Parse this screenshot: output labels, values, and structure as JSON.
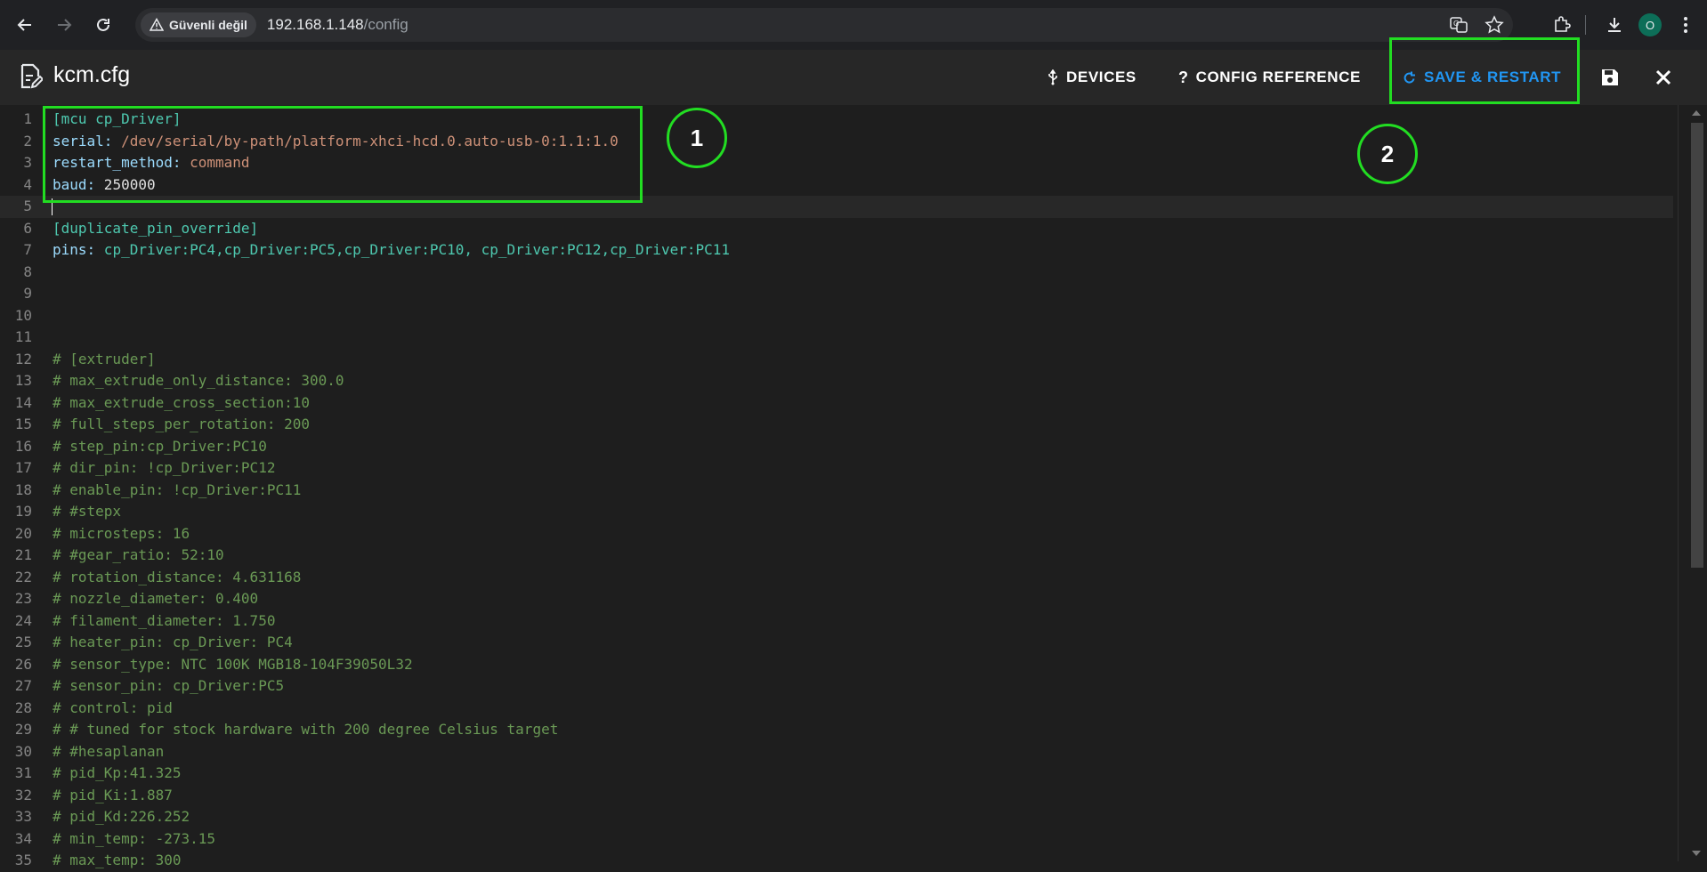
{
  "browser": {
    "security_label": "Güvenli değil",
    "url_host": "192.168.1.148",
    "url_path": "/config",
    "profile_initial": "O"
  },
  "header": {
    "file_name": "kcm.cfg",
    "devices_label": "DEVICES",
    "config_reference_label": "CONFIG REFERENCE",
    "save_restart_label": "SAVE & RESTART"
  },
  "editor": {
    "current_line": 5,
    "lines": [
      {
        "n": "1",
        "segs": [
          {
            "t": "[mcu cp_Driver]",
            "c": "section"
          }
        ]
      },
      {
        "n": "2",
        "segs": [
          {
            "t": "serial:",
            "c": "key"
          },
          {
            "t": " /dev/serial/by-path/platform-xhci-hcd.0.auto-usb-0:1.1:1.0",
            "c": "val"
          }
        ]
      },
      {
        "n": "3",
        "segs": [
          {
            "t": "restart_method:",
            "c": "key"
          },
          {
            "t": " command",
            "c": "val"
          }
        ]
      },
      {
        "n": "4",
        "segs": [
          {
            "t": "baud:",
            "c": "key"
          },
          {
            "t": " 250000",
            "c": "num"
          }
        ]
      },
      {
        "n": "5",
        "segs": []
      },
      {
        "n": "6",
        "segs": [
          {
            "t": "[duplicate_pin_override]",
            "c": "section"
          }
        ]
      },
      {
        "n": "7",
        "segs": [
          {
            "t": "pins:",
            "c": "key"
          },
          {
            "t": " cp_Driver:PC4,cp_Driver:PC5,cp_Driver:PC10, cp_Driver:PC12,cp_Driver:PC11",
            "c": "section"
          }
        ]
      },
      {
        "n": "8",
        "segs": []
      },
      {
        "n": "9",
        "segs": []
      },
      {
        "n": "10",
        "segs": []
      },
      {
        "n": "11",
        "segs": []
      },
      {
        "n": "12",
        "segs": [
          {
            "t": "# [extruder]",
            "c": "comment"
          }
        ]
      },
      {
        "n": "13",
        "segs": [
          {
            "t": "# max_extrude_only_distance: 300.0",
            "c": "comment"
          }
        ]
      },
      {
        "n": "14",
        "segs": [
          {
            "t": "# max_extrude_cross_section:10",
            "c": "comment"
          }
        ]
      },
      {
        "n": "15",
        "segs": [
          {
            "t": "# full_steps_per_rotation: 200",
            "c": "comment"
          }
        ]
      },
      {
        "n": "16",
        "segs": [
          {
            "t": "# step_pin:cp_Driver:PC10",
            "c": "comment"
          }
        ]
      },
      {
        "n": "17",
        "segs": [
          {
            "t": "# dir_pin: !cp_Driver:PC12",
            "c": "comment"
          }
        ]
      },
      {
        "n": "18",
        "segs": [
          {
            "t": "# enable_pin: !cp_Driver:PC11",
            "c": "comment"
          }
        ]
      },
      {
        "n": "19",
        "segs": [
          {
            "t": "# #stepx",
            "c": "comment"
          }
        ]
      },
      {
        "n": "20",
        "segs": [
          {
            "t": "# microsteps: 16",
            "c": "comment"
          }
        ]
      },
      {
        "n": "21",
        "segs": [
          {
            "t": "# #gear_ratio: 52:10",
            "c": "comment"
          }
        ]
      },
      {
        "n": "22",
        "segs": [
          {
            "t": "# rotation_distance: 4.631168",
            "c": "comment"
          }
        ]
      },
      {
        "n": "23",
        "segs": [
          {
            "t": "# nozzle_diameter: 0.400",
            "c": "comment"
          }
        ]
      },
      {
        "n": "24",
        "segs": [
          {
            "t": "# filament_diameter: 1.750",
            "c": "comment"
          }
        ]
      },
      {
        "n": "25",
        "segs": [
          {
            "t": "# heater_pin: cp_Driver: PC4",
            "c": "comment"
          }
        ]
      },
      {
        "n": "26",
        "segs": [
          {
            "t": "# sensor_type: NTC 100K MGB18-104F39050L32",
            "c": "comment"
          }
        ]
      },
      {
        "n": "27",
        "segs": [
          {
            "t": "# sensor_pin: cp_Driver:PC5",
            "c": "comment"
          }
        ]
      },
      {
        "n": "28",
        "segs": [
          {
            "t": "# control: pid",
            "c": "comment"
          }
        ]
      },
      {
        "n": "29",
        "segs": [
          {
            "t": "# # tuned for stock hardware with 200 degree Celsius target",
            "c": "comment"
          }
        ]
      },
      {
        "n": "30",
        "segs": [
          {
            "t": "# #hesaplanan",
            "c": "comment"
          }
        ]
      },
      {
        "n": "31",
        "segs": [
          {
            "t": "# pid_Kp:41.325",
            "c": "comment"
          }
        ]
      },
      {
        "n": "32",
        "segs": [
          {
            "t": "# pid_Ki:1.887",
            "c": "comment"
          }
        ]
      },
      {
        "n": "33",
        "segs": [
          {
            "t": "# pid_Kd:226.252",
            "c": "comment"
          }
        ]
      },
      {
        "n": "34",
        "segs": [
          {
            "t": "# min_temp: -273.15",
            "c": "comment"
          }
        ]
      },
      {
        "n": "35",
        "segs": [
          {
            "t": "# max_temp: 300",
            "c": "comment"
          }
        ]
      }
    ]
  },
  "annotations": {
    "label_1": "1",
    "label_2": "2",
    "color": "#22dd22"
  },
  "colors": {
    "accent": "#2196f3",
    "section": "#4ec9b0",
    "key": "#9cdcfe",
    "value": "#ce9178",
    "comment": "#6a9955"
  }
}
